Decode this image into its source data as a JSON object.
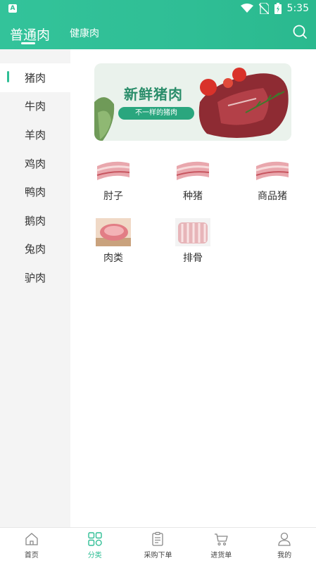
{
  "status_bar": {
    "time": "5:35"
  },
  "header": {
    "active_tab": "普通肉",
    "tab_2": "健康肉"
  },
  "sidebar": {
    "items": [
      {
        "label": "猪肉",
        "active": true
      },
      {
        "label": "牛肉"
      },
      {
        "label": "羊肉"
      },
      {
        "label": "鸡肉"
      },
      {
        "label": "鸭肉"
      },
      {
        "label": "鹅肉"
      },
      {
        "label": "兔肉"
      },
      {
        "label": "驴肉"
      }
    ]
  },
  "banner": {
    "title": "新鲜猪肉",
    "subtitle": "不一样的猪肉"
  },
  "categories": [
    {
      "label": "肘子"
    },
    {
      "label": "种猪"
    },
    {
      "label": "商品猪"
    },
    {
      "label": "肉类"
    },
    {
      "label": "排骨"
    }
  ],
  "bottom_nav": [
    {
      "label": "首页",
      "icon": "home-icon"
    },
    {
      "label": "分类",
      "icon": "category-icon",
      "active": true
    },
    {
      "label": "采购下单",
      "icon": "order-icon"
    },
    {
      "label": "进货单",
      "icon": "cart-icon"
    },
    {
      "label": "我的",
      "icon": "user-icon"
    }
  ],
  "colors": {
    "accent": "#2fbe95",
    "sidebar_bg": "#f4f4f4"
  }
}
